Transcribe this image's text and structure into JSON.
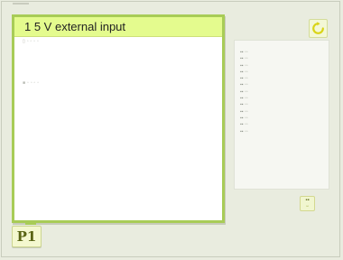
{
  "dialog": {
    "title": "1 5 V external input",
    "line1": "▯ ▫ ▫ ▫ ▫",
    "line2": "■ ▫ ▫ ▫ ▫"
  },
  "readout": [
    {
      "label": "▪▪",
      "value": "▫▫"
    },
    {
      "label": "▪▪",
      "value": "▫▫"
    },
    {
      "label": "▪▪",
      "value": "▫▫"
    },
    {
      "label": "▪▪",
      "value": "▫▫"
    },
    {
      "label": "▪▪",
      "value": "▫▫"
    },
    {
      "label": "▪▪",
      "value": "▫▫"
    },
    {
      "label": "▪▪",
      "value": "▫▫"
    },
    {
      "label": "▪▪",
      "value": "▫▫"
    },
    {
      "label": "▪▪",
      "value": "▫▫"
    },
    {
      "label": "▪▪",
      "value": "▫▫"
    },
    {
      "label": "▪▪",
      "value": "▫▫"
    },
    {
      "label": "▪▪",
      "value": "▫▫"
    },
    {
      "label": "▪▪",
      "value": "▫▫"
    }
  ],
  "buttons": {
    "refresh_icon": "refresh-icon",
    "small_glyph_top": "▪▪",
    "small_glyph_bottom": "▫▫",
    "page_label": "P1"
  },
  "colors": {
    "accent": "#a8cc57",
    "header": "#e4fb8e",
    "background": "#e9ecdf",
    "icon": "#d9d417"
  }
}
